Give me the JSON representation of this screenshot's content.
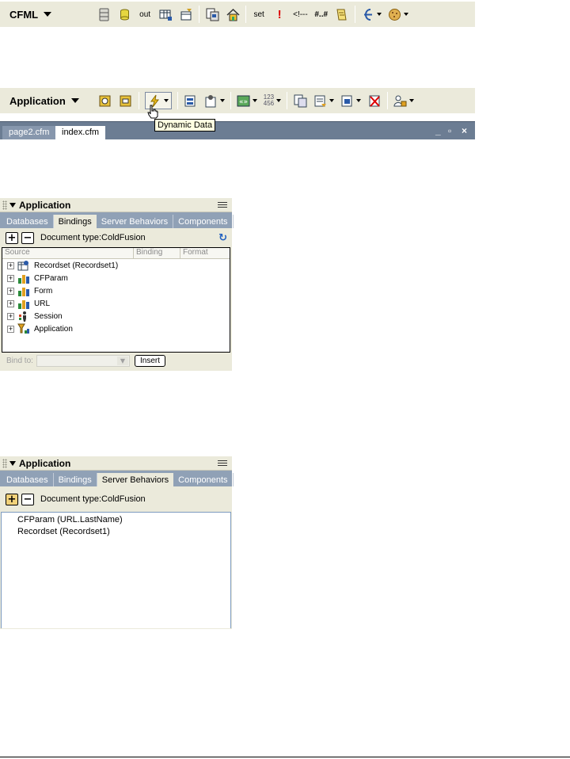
{
  "cfml_toolbar": {
    "title": "CFML",
    "items": [
      {
        "icon": "cfquery-icon"
      },
      {
        "icon": "cfoutput-db-icon"
      },
      {
        "label": "out"
      },
      {
        "icon": "cfinsert-icon"
      },
      {
        "icon": "cfupdate-icon"
      },
      {
        "sep": true
      },
      {
        "icon": "cfinclude-icon"
      },
      {
        "icon": "cflocation-icon"
      },
      {
        "sep": true
      },
      {
        "label": "set"
      },
      {
        "label": "!"
      },
      {
        "label": "<!---"
      },
      {
        "label": "#..#"
      },
      {
        "icon": "cfscript-icon"
      },
      {
        "sep": true
      },
      {
        "icon": "cfif-icon",
        "dropdown": true
      },
      {
        "icon": "cookie-icon",
        "dropdown": true
      }
    ]
  },
  "app_toolbar": {
    "title": "Application",
    "tooltip": "Dynamic Data"
  },
  "doc_tabs": {
    "tabs": [
      "page2.cfm",
      "index.cfm"
    ],
    "active": "index.cfm"
  },
  "bindings_panel": {
    "title": "Application",
    "tabs": [
      "Databases",
      "Bindings",
      "Server Behaviors",
      "Components"
    ],
    "active_tab": "Bindings",
    "add_symbol": "+",
    "remove_symbol": "−",
    "doc_type": "Document type:ColdFusion",
    "columns": [
      "Source",
      "Binding",
      "Format"
    ],
    "rows": [
      {
        "label": "Recordset (Recordset1)",
        "icon": "recordset-icon"
      },
      {
        "label": "CFParam",
        "icon": "variables-icon"
      },
      {
        "label": "Form",
        "icon": "variables-icon"
      },
      {
        "label": "URL",
        "icon": "variables-icon"
      },
      {
        "label": "Session",
        "icon": "session-icon"
      },
      {
        "label": "Application",
        "icon": "application-icon"
      }
    ],
    "bind_to_label": "Bind to:",
    "insert_label": "Insert"
  },
  "server_panel": {
    "title": "Application",
    "tabs": [
      "Databases",
      "Bindings",
      "Server Behaviors",
      "Components"
    ],
    "active_tab": "Server Behaviors",
    "add_symbol": "+",
    "remove_symbol": "−",
    "doc_type": "Document type:ColdFusion",
    "items": [
      "CFParam (URL.LastName)",
      "Recordset (Recordset1)"
    ]
  },
  "colors": {
    "toolbar_bg": "#ebeadb",
    "tab_strip": "#90a1b6",
    "doc_tab_strip": "#6c7d93"
  }
}
